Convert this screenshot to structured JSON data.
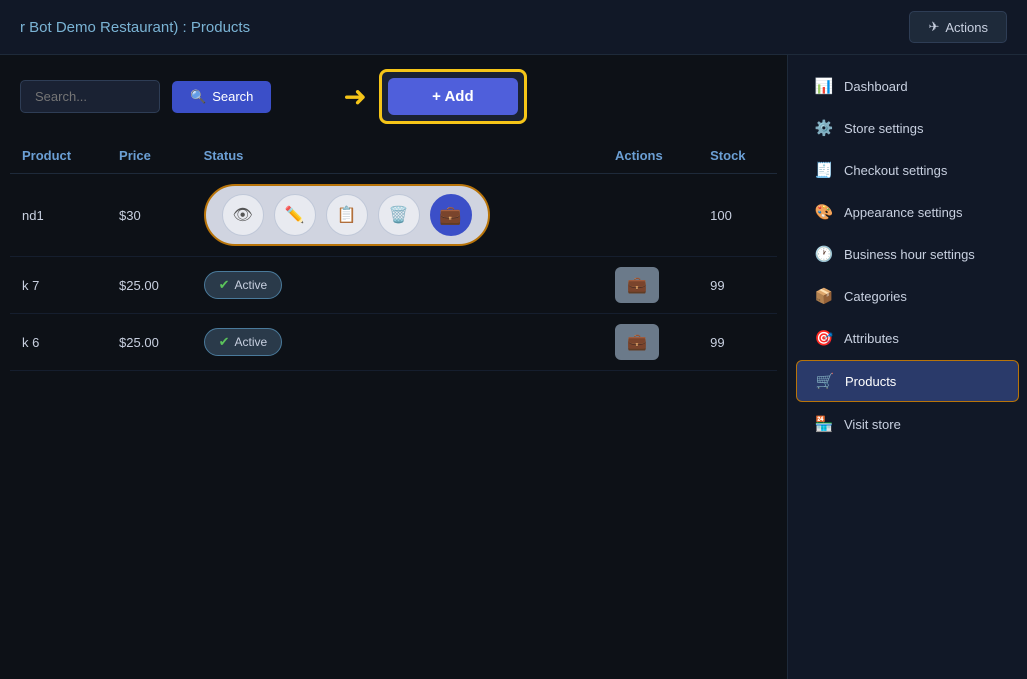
{
  "header": {
    "title": "r Bot Demo Restaurant) : Products",
    "actions_label": "Actions"
  },
  "toolbar": {
    "search_placeholder": "Search...",
    "search_label": "Search",
    "add_label": "+ Add"
  },
  "table": {
    "columns": [
      "Product",
      "Price",
      "Status",
      "Actions",
      "Stock"
    ],
    "rows": [
      {
        "id": "row1",
        "product": "nd1",
        "price": "$30",
        "status": "expanded_actions",
        "stock": "100"
      },
      {
        "id": "row2",
        "product": "k 7",
        "price": "$25.00",
        "status": "Active",
        "stock": "99"
      },
      {
        "id": "row3",
        "product": "k 6",
        "price": "$25.00",
        "status": "Active",
        "stock": "99"
      }
    ]
  },
  "sidebar": {
    "items": [
      {
        "id": "dashboard",
        "label": "Dashboard",
        "icon": "📊"
      },
      {
        "id": "store-settings",
        "label": "Store settings",
        "icon": "⚙️"
      },
      {
        "id": "checkout-settings",
        "label": "Checkout settings",
        "icon": "🧾"
      },
      {
        "id": "appearance-settings",
        "label": "Appearance settings",
        "icon": "🎨"
      },
      {
        "id": "business-hours",
        "label": "Business hour settings",
        "icon": "🕐"
      },
      {
        "id": "categories",
        "label": "Categories",
        "icon": "📦"
      },
      {
        "id": "attributes",
        "label": "Attributes",
        "icon": "🎯"
      },
      {
        "id": "products",
        "label": "Products",
        "icon": "🛒",
        "active": true
      },
      {
        "id": "visit-store",
        "label": "Visit store",
        "icon": "🏪"
      }
    ]
  }
}
